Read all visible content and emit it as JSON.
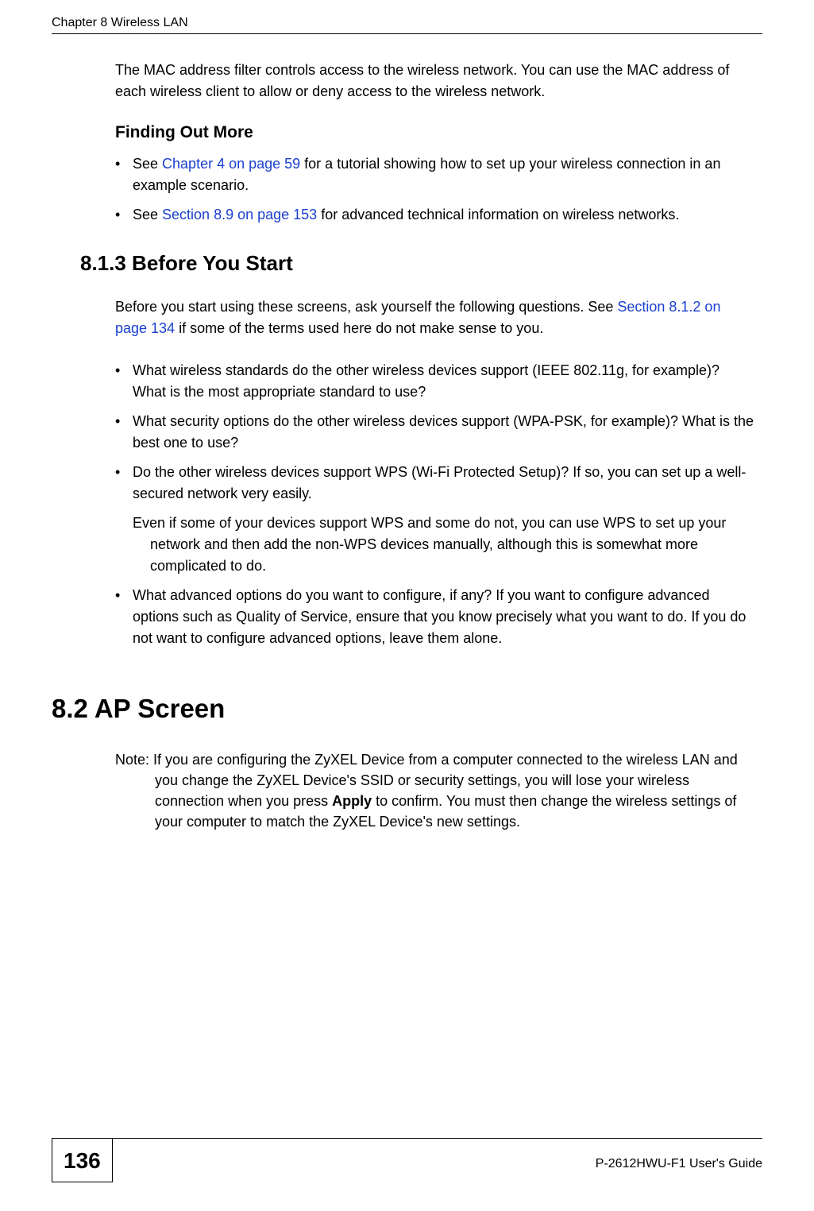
{
  "header": {
    "chapter": "Chapter 8 Wireless LAN"
  },
  "intro_para": "The MAC address filter controls access to the wireless network. You can use the MAC address of each wireless client to allow or deny access to the wireless network.",
  "finding": {
    "heading": "Finding Out More",
    "items": [
      {
        "pre": "See ",
        "link": "Chapter 4 on page 59",
        "post": " for a tutorial showing how to set up your wireless connection in an example scenario."
      },
      {
        "pre": "See ",
        "link": "Section 8.9 on page 153",
        "post": " for advanced technical information on wireless networks."
      }
    ]
  },
  "before": {
    "heading": "8.1.3  Before You Start",
    "para_pre": "Before you start using these screens, ask yourself the following questions. See ",
    "para_link": "Section 8.1.2 on page 134",
    "para_post": " if some of the terms used here do not make sense to you.",
    "items": [
      "What wireless standards do the other wireless devices support (IEEE 802.11g, for example)? What is the most appropriate standard to use?",
      "What security options do the other wireless devices support (WPA-PSK, for example)? What is the best one to use?",
      "Do the other wireless devices support WPS (Wi-Fi Protected Setup)? If so, you can set up a well-secured network very easily."
    ],
    "item3_sub": "Even if some of your devices support WPS and some do not, you can use WPS to set up your network and then add the non-WPS devices manually, although this is somewhat more complicated to do.",
    "item4": "What advanced options do you want to configure, if any? If you want to configure advanced options such as Quality of Service, ensure that you know precisely what you want to do. If you do not want to configure advanced options, leave them alone."
  },
  "ap": {
    "heading": "8.2  AP Screen",
    "note_label": "Note: ",
    "note_pre": "If you are configuring the ZyXEL Device from a computer connected to the wireless LAN and you change the ZyXEL Device's SSID or security settings, you will lose your wireless connection when you press ",
    "note_bold": "Apply",
    "note_post": " to confirm. You must then change the wireless settings of your computer to match the ZyXEL Device's new settings."
  },
  "footer": {
    "page": "136",
    "guide": "P-2612HWU-F1 User's Guide"
  }
}
